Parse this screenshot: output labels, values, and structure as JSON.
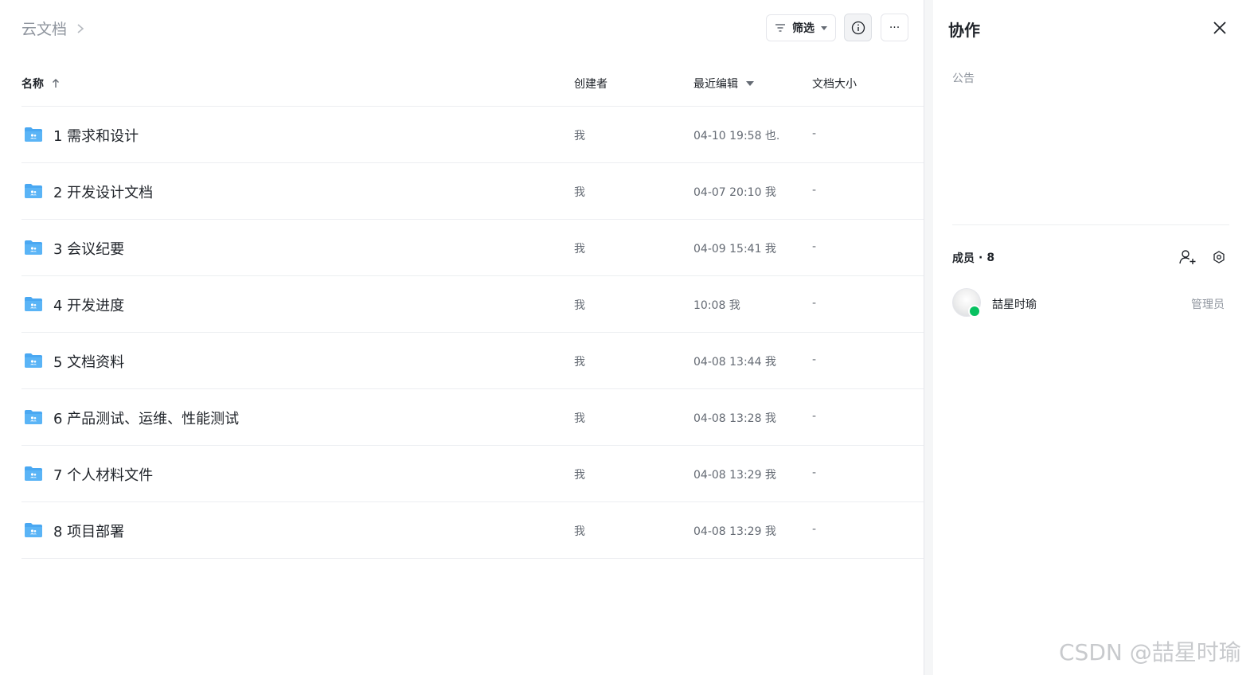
{
  "breadcrumb": {
    "root": "云文档"
  },
  "toolbar": {
    "filter_label": "筛选",
    "more_label": "···"
  },
  "table": {
    "columns": {
      "name": "名称",
      "creator": "创建者",
      "edited": "最近编辑",
      "size": "文档大小"
    },
    "rows": [
      {
        "name": "1 需求和设计",
        "creator": "我",
        "edited": "04-10 19:58 也.",
        "size": "-"
      },
      {
        "name": "2 开发设计文档",
        "creator": "我",
        "edited": "04-07 20:10 我",
        "size": "-"
      },
      {
        "name": "3 会议纪要",
        "creator": "我",
        "edited": "04-09 15:41 我",
        "size": "-"
      },
      {
        "name": "4 开发进度",
        "creator": "我",
        "edited": "10:08 我",
        "size": "-"
      },
      {
        "name": "5 文档资料",
        "creator": "我",
        "edited": "04-08 13:44 我",
        "size": "-"
      },
      {
        "name": "6 产品测试、运维、性能测试",
        "creator": "我",
        "edited": "04-08 13:28 我",
        "size": "-"
      },
      {
        "name": "7 个人材料文件",
        "creator": "我",
        "edited": "04-08 13:29 我",
        "size": "-"
      },
      {
        "name": "8 项目部署",
        "creator": "我",
        "edited": "04-08 13:29 我",
        "size": "-"
      }
    ]
  },
  "panel": {
    "title": "协作",
    "notice_label": "公告",
    "members_label": "成员",
    "members_separator": "·",
    "members_count": "8",
    "members": [
      {
        "name": "喆星时瑜",
        "role": "管理员"
      }
    ]
  },
  "watermark": "CSDN @喆星时瑜",
  "colors": {
    "folder": "#4aa8f2",
    "text_primary": "#1f2329",
    "text_secondary": "#646a73",
    "text_muted": "#8f959e",
    "wechat_green": "#07c160"
  },
  "icons": {
    "breadcrumb_chevron": "chevron-right-icon",
    "filter": "filter-icon",
    "info": "info-icon",
    "more": "more-icon",
    "sort_asc": "arrow-up-icon",
    "sort_desc": "caret-down-icon",
    "folder": "shared-folder-icon",
    "close": "close-icon",
    "add_member": "add-user-icon",
    "settings": "gear-icon"
  }
}
